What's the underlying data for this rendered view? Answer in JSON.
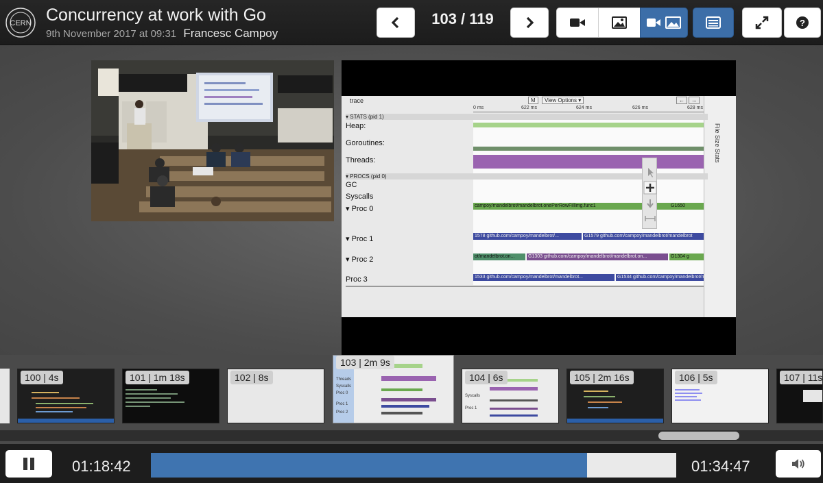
{
  "header": {
    "logo_text": "CERN",
    "title": "Concurrency at work with Go",
    "date": "9th November 2017 at 09:31",
    "author": "Francesc Campoy",
    "slide_counter": "103 / 119",
    "prev_icon": "chevron-left-icon",
    "next_icon": "chevron-right-icon",
    "view_modes": [
      {
        "icon": "video-camera-icon",
        "active": false
      },
      {
        "icon": "image-icon",
        "active": false
      },
      {
        "icon": "video-and-image-icon",
        "active": true
      }
    ],
    "toc_icon": "list-icon",
    "fullscreen_icon": "expand-icon",
    "help_icon": "question-circle-icon"
  },
  "slide": {
    "trace": {
      "toolbar": {
        "title": "trace",
        "m_btn": "M",
        "view_options": "View Options ▾",
        "arrows": [
          "←",
          "→",
          "=",
          "?"
        ]
      },
      "ruler": [
        "0 ms",
        "622 ms",
        "624 ms",
        "626 ms",
        "628 ms"
      ],
      "side_label": "File Size Stats",
      "stats_section": "▾ STATS (pid 1)",
      "procs_section": "▾ PROCS (pid 0)",
      "rows": [
        "Heap:",
        "Goroutines:",
        "Threads:",
        "GC",
        "Syscalls",
        "▾  Proc 0",
        "▾  Proc 1",
        "▾  Proc 2",
        "Proc 3"
      ],
      "bars": {
        "proc0_a": "campoy/mandelbrot/mandelbrot.onePerRowFillImg.func1",
        "proc0_b": "G1650",
        "proc1_a": "1578 github.com/campoy/mandelbrot/...",
        "proc1_b": "G1579 github.com/campoy/mandelbrot/mandelbrot",
        "proc2_a": "ot/mandelbrot.on...",
        "proc2_b": "G1303 github.com/campoy/mandelbrot/mandelbrot.on...",
        "proc2_c": "G1304 g",
        "proc3_a": "1533 github.com/campoy/mandelbrot/mandelbrot...",
        "proc3_b": "G1534 github.com/campoy/mandelbrot/mandelbrot"
      }
    }
  },
  "thumbnails": [
    {
      "label": "100 | 4s",
      "style": "code-dark"
    },
    {
      "label": "101 | 1m 18s",
      "style": "terminal"
    },
    {
      "label": "102 | 8s",
      "style": "blank-light"
    },
    {
      "label": "103 | 2m 9s",
      "style": "trace",
      "current": true
    },
    {
      "label": "104 | 6s",
      "style": "trace"
    },
    {
      "label": "105 | 2m 16s",
      "style": "code-dark"
    },
    {
      "label": "106 | 5s",
      "style": "blank-links"
    },
    {
      "label": "107 | 11s",
      "style": "dark-small"
    }
  ],
  "player": {
    "pause_icon": "pause-icon",
    "current_time": "01:18:42",
    "total_time": "01:34:47",
    "progress_fraction": 0.83,
    "volume_icon": "volume-icon"
  },
  "colors": {
    "accent": "#3c6ea8",
    "progress": "#3f74b0"
  }
}
